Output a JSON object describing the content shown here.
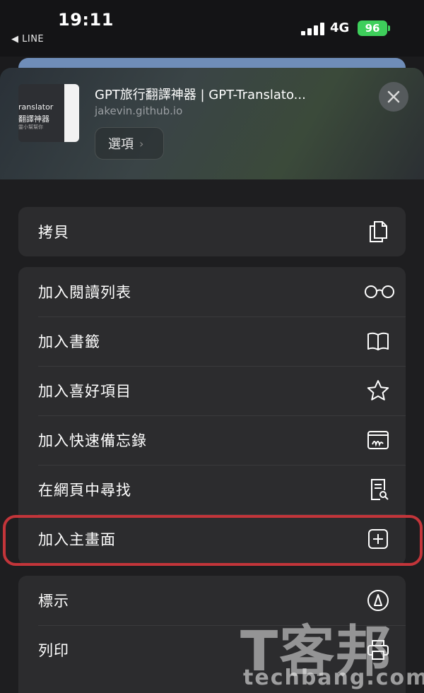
{
  "status_bar": {
    "time": "19:11",
    "back_label": "◀ LINE",
    "network": "4G",
    "battery": "96"
  },
  "share_sheet": {
    "thumbnail_line1": "ranslator",
    "thumbnail_line2": "翻譯神器",
    "thumbnail_line3": "靈小幫幫你",
    "page_title": "GPT旅行翻譯神器 | GPT-Translato...",
    "page_domain": "jakevin.github.io",
    "options_label": "選項",
    "close_icon": "close-icon"
  },
  "groups": [
    {
      "items": [
        {
          "label": "拷貝",
          "icon": "copy-icon"
        }
      ]
    },
    {
      "items": [
        {
          "label": "加入閱讀列表",
          "icon": "glasses-icon"
        },
        {
          "label": "加入書籤",
          "icon": "book-icon"
        },
        {
          "label": "加入喜好項目",
          "icon": "star-icon"
        },
        {
          "label": "加入快速備忘錄",
          "icon": "quick-note-icon"
        },
        {
          "label": "在網頁中尋找",
          "icon": "find-in-page-icon"
        },
        {
          "label": "加入主畫面",
          "icon": "add-square-icon"
        }
      ]
    },
    {
      "items": [
        {
          "label": "標示",
          "icon": "markup-icon"
        },
        {
          "label": "列印",
          "icon": "printer-icon"
        }
      ]
    }
  ],
  "watermark": {
    "chinese": "T客邦",
    "latin": "techbang.com"
  },
  "colors": {
    "highlight": "#c3353a",
    "battery": "#3ecf5b",
    "sheet": "#1e1e20",
    "row": "#2c2c2e"
  }
}
